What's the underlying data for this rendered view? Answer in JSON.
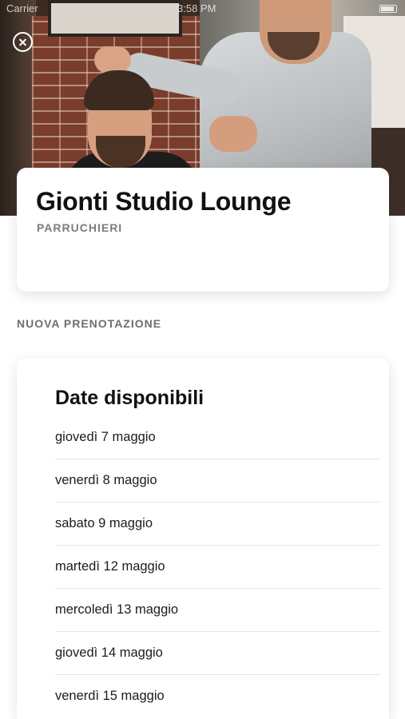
{
  "status_bar": {
    "carrier": "Carrier",
    "time": "3:58 PM"
  },
  "hero": {
    "image": "barber-cutting-hair-photo",
    "close_icon": "close-circle-icon"
  },
  "business": {
    "name": "Gionti Studio Lounge",
    "category": "PARRUCHIERI"
  },
  "section": {
    "label": "NUOVA PRENOTAZIONE"
  },
  "dates": {
    "title": "Date disponibili",
    "items": [
      {
        "label": "giovedì 7 maggio"
      },
      {
        "label": "venerdì 8 maggio"
      },
      {
        "label": "sabato 9 maggio"
      },
      {
        "label": "martedì 12 maggio"
      },
      {
        "label": "mercoledì 13 maggio"
      },
      {
        "label": "giovedì 14 maggio"
      },
      {
        "label": "venerdì 15 maggio"
      }
    ]
  }
}
